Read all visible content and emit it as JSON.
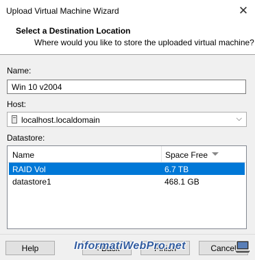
{
  "window": {
    "title": "Upload Virtual Machine Wizard"
  },
  "header": {
    "title": "Select a Destination Location",
    "subtitle": "Where would you like to store the uploaded virtual machine?"
  },
  "form": {
    "name_label": "Name:",
    "name_value": "Win 10 v2004",
    "host_label": "Host:",
    "host_value": "localhost.localdomain",
    "datastore_label": "Datastore:"
  },
  "datastore_table": {
    "columns": [
      "Name",
      "Space Free"
    ],
    "rows": [
      {
        "name": "RAID Vol",
        "space": "6.7 TB",
        "selected": true
      },
      {
        "name": "datastore1",
        "space": "468.1 GB",
        "selected": false
      }
    ]
  },
  "buttons": {
    "help": "Help",
    "back": "< Back",
    "finish": "Finish",
    "cancel": "Cancel"
  },
  "watermark": {
    "text": "InformatiWebPro.net"
  },
  "colors": {
    "selection": "#0078d7",
    "watermark": "#1f4e9a"
  },
  "icons": {
    "close": "close-icon",
    "host": "host-icon",
    "sort": "sort-descending-icon"
  }
}
